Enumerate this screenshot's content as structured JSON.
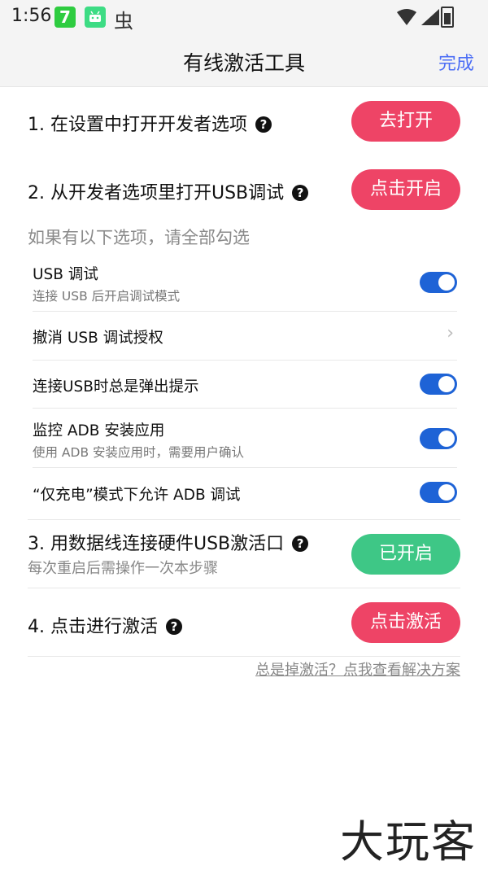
{
  "status_bar": {
    "time": "1:56",
    "app1_glyph": "7",
    "app3_glyph": "虫",
    "icons": [
      "wifi-icon",
      "signal-icon",
      "battery-icon"
    ]
  },
  "header": {
    "title": "有线激活工具",
    "done_label": "完成"
  },
  "steps": [
    {
      "label": "1. 在设置中打开开发者选项",
      "button": "去打开",
      "color": "#ee4466"
    },
    {
      "label": "2. 从开发者选项里打开USB调试",
      "button": "点击开启",
      "color": "#ee4466"
    },
    {
      "label": "3. 用数据线连接硬件USB激活口",
      "sub": "每次重启后需操作一次本步骤",
      "button": "已开启",
      "color": "#3ec786"
    },
    {
      "label": "4. 点击进行激活",
      "button": "点击激活",
      "color": "#ee4466"
    }
  ],
  "help_glyph": "?",
  "hint": "如果有以下选项，请全部勾选",
  "options": [
    {
      "title": "USB 调试",
      "sub": "连接 USB 后开启调试模式",
      "control": "toggle",
      "on": true
    },
    {
      "title": "撤消 USB 调试授权",
      "control": "chevron"
    },
    {
      "title": "连接USB时总是弹出提示",
      "control": "toggle",
      "on": true
    },
    {
      "title": "监控 ADB 安装应用",
      "sub": "使用 ADB 安装应用时，需要用户确认",
      "control": "toggle",
      "on": true
    },
    {
      "title": "“仅充电”模式下允许 ADB 调试",
      "control": "toggle",
      "on": true
    }
  ],
  "chevron_glyph": "›",
  "help_link": "总是掉激活？点我查看解决方案",
  "watermark": "大玩客"
}
